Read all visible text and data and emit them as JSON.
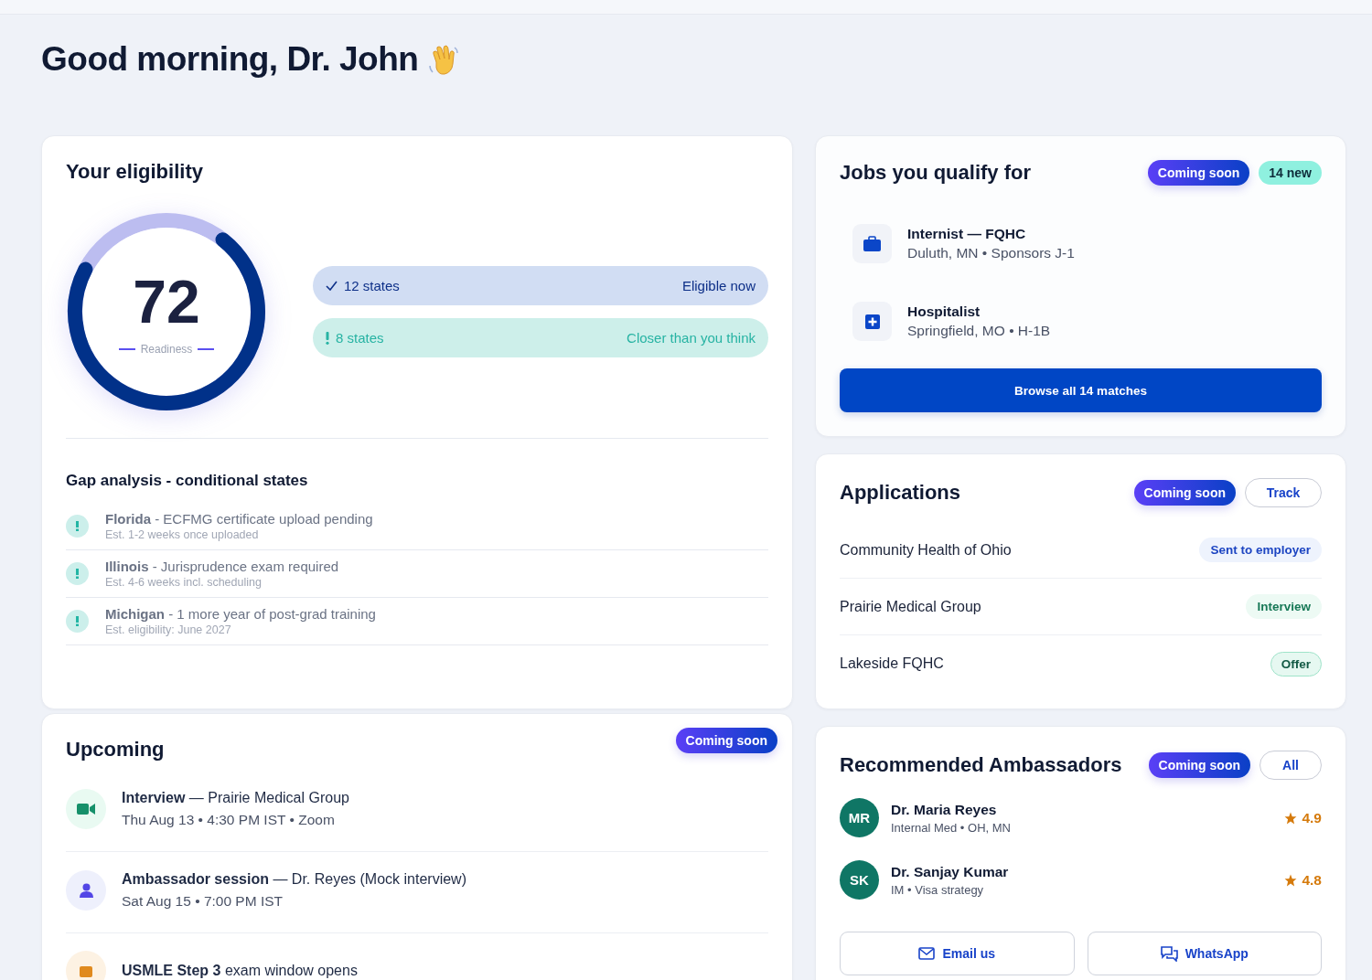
{
  "greeting": "Good morning, Dr. John",
  "eligibility": {
    "title": "Your eligibility",
    "score": "72",
    "score_label": "Readiness",
    "level": 0.72,
    "pills": [
      {
        "kind": "eligible",
        "count": "12 states",
        "label": "Eligible now"
      },
      {
        "kind": "closer",
        "count": "8 states",
        "label": "Closer than you think"
      }
    ],
    "gap_title": "Gap analysis - conditional states",
    "gaps": [
      {
        "text": "**Florida** - ECFMG certificate upload pending",
        "estimate": "Est. 1-2 weeks once uploaded"
      },
      {
        "text": "**Illinois** - Jurisprudence exam required",
        "estimate": "Est. 4-6 weeks incl. scheduling"
      },
      {
        "text": "**Michigan** - 1 more year of post-grad training",
        "estimate": "Est. eligibility: June 2027"
      }
    ]
  },
  "upcoming": {
    "title": "Upcoming",
    "badge": "Coming soon",
    "items": [
      {
        "kind": "video",
        "text": "**Interview** — Prairie Medical Group",
        "detail": "Thu Aug 13 • 4:30 PM IST • Zoom"
      },
      {
        "kind": "person",
        "text": "**Ambassador session** — Dr. Reyes (Mock interview)",
        "detail": "Sat Aug 15 • 7:00 PM IST"
      },
      {
        "kind": "exam",
        "text": "**USMLE Step 3** exam window opens"
      }
    ]
  },
  "jobs": {
    "title": "Jobs you qualify for",
    "badge": "Coming soon",
    "new_count": "14 new",
    "items": [
      {
        "kind": "briefcase",
        "title": "Internist — FQHC",
        "detail": "Duluth, MN • Sponsors J-1"
      },
      {
        "kind": "hospital",
        "title": "Hospitalist",
        "detail": "Springfield, MO • H-1B"
      }
    ],
    "button": "Browse all 14 matches"
  },
  "applications": {
    "title": "Applications",
    "badge": "Coming soon",
    "action": "Track",
    "items": [
      {
        "name": "Community Health of Ohio",
        "status": "Sent to employer",
        "kind": "sent"
      },
      {
        "name": "Prairie Medical Group",
        "status": "Interview",
        "kind": "interview"
      },
      {
        "name": "Lakeside FQHC",
        "status": "Offer",
        "kind": "offer"
      }
    ]
  },
  "ambassadors": {
    "title": "Recommended Ambassadors",
    "badge": "Coming soon",
    "action": "All",
    "items": [
      {
        "initials": "MR",
        "name": "Dr. Maria Reyes",
        "detail": "Internal Med • OH, MN",
        "rating": "4.9"
      },
      {
        "initials": "SK",
        "name": "Dr. Sanjay Kumar",
        "detail": "IM • Visa strategy",
        "rating": "4.8"
      }
    ],
    "buttons": [
      {
        "kind": "email",
        "label": "Email us"
      },
      {
        "kind": "chat",
        "label": "WhatsApp"
      }
    ]
  }
}
